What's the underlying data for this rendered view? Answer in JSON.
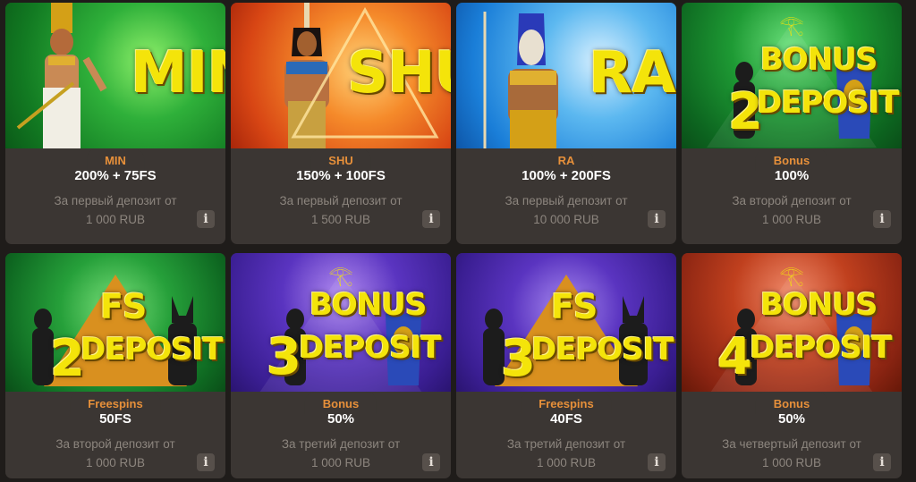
{
  "cards": [
    {
      "tag": "MIN",
      "offer": "200% + 75FS",
      "desc1": "За первый депозит от",
      "desc2": "1 000 RUB",
      "info": "i",
      "banner_text": "MIN",
      "bg": "#1e9a2c"
    },
    {
      "tag": "SHU",
      "offer": "150% + 100FS",
      "desc1": "За первый депозит от",
      "desc2": "1 500 RUB",
      "info": "i",
      "banner_text": "SHU",
      "bg": "#e8561a"
    },
    {
      "tag": "RA",
      "offer": "100% + 200FS",
      "desc1": "За первый депозит от",
      "desc2": "10 000 RUB",
      "info": "i",
      "banner_text": "RA",
      "bg": "#1d8ee0"
    },
    {
      "tag": "Bonus",
      "offer": "100%",
      "desc1": "За второй депозит от",
      "desc2": "1 000 RUB",
      "info": "i",
      "banner_line1": "BONUS",
      "banner_num": "2",
      "banner_line2": "DEPOSIT",
      "bg": "#1b8a2a"
    },
    {
      "tag": "Freespins",
      "offer": "50FS",
      "desc1": "За второй депозит от",
      "desc2": "1 000 RUB",
      "info": "i",
      "banner_line1": "FS",
      "banner_num": "2",
      "banner_line2": "DEPOSIT",
      "bg": "#1b8a2a"
    },
    {
      "tag": "Bonus",
      "offer": "50%",
      "desc1": "За третий депозит от",
      "desc2": "1 000 RUB",
      "info": "i",
      "banner_line1": "BONUS",
      "banner_num": "3",
      "banner_line2": "DEPOSIT",
      "bg": "#4a2aa8"
    },
    {
      "tag": "Freespins",
      "offer": "40FS",
      "desc1": "За третий депозит от",
      "desc2": "1 000 RUB",
      "info": "i",
      "banner_line1": "FS",
      "banner_num": "3",
      "banner_line2": "DEPOSIT",
      "bg": "#4a2aa8"
    },
    {
      "tag": "Bonus",
      "offer": "50%",
      "desc1": "За четвертый депозит от",
      "desc2": "1 000 RUB",
      "info": "i",
      "banner_line1": "BONUS",
      "banner_num": "4",
      "banner_line2": "DEPOSIT",
      "bg": "#9a2a1a"
    }
  ],
  "colors": {
    "tag": "#e7903a",
    "card": "#3b3633",
    "page": "#1f1c1a",
    "title_yellow": "#f4e40a"
  }
}
